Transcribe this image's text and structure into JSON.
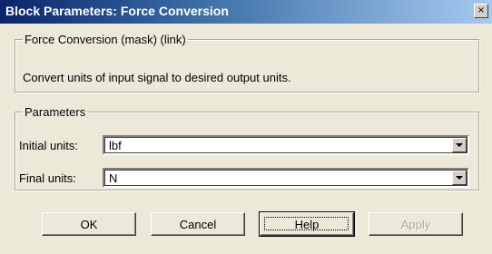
{
  "window": {
    "title": "Block Parameters: Force Conversion",
    "close_glyph": "×"
  },
  "description_group": {
    "legend": "Force Conversion (mask) (link)",
    "text": "Convert units of input signal to desired output units."
  },
  "parameters_group": {
    "legend": "Parameters",
    "initial_units": {
      "label": "Initial units:",
      "value": "lbf"
    },
    "final_units": {
      "label": "Final units:",
      "value": "N"
    }
  },
  "buttons": {
    "ok": "OK",
    "cancel": "Cancel",
    "help": "Help",
    "apply": "Apply"
  },
  "icons": {
    "close": "close-icon",
    "dropdown": "chevron-down-icon"
  }
}
